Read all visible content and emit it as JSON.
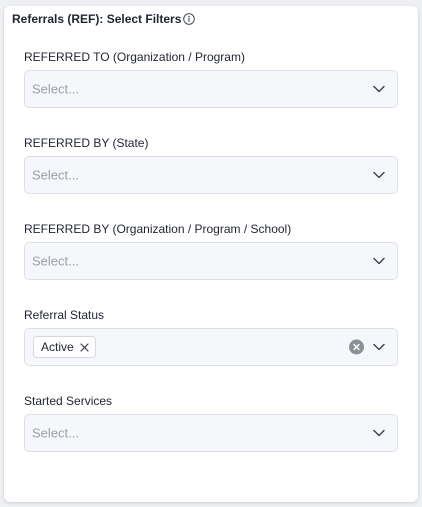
{
  "panel": {
    "title": "Referrals (REF): Select Filters"
  },
  "filters": [
    {
      "label": "REFERRED TO (Organization / Program)",
      "placeholder": "Select..."
    },
    {
      "label": "REFERRED BY (State)",
      "placeholder": "Select..."
    },
    {
      "label": "REFERRED BY (Organization / Program / School)",
      "placeholder": "Select..."
    },
    {
      "label": "Referral Status",
      "selected_tags": [
        "Active"
      ]
    },
    {
      "label": "Started Services",
      "placeholder": "Select..."
    }
  ],
  "icons": {
    "info": "info-icon",
    "dropdown": "chevron-down-icon",
    "clear": "clear-icon",
    "tag_remove": "close-icon"
  },
  "colors": {
    "panel_bg": "#ffffff",
    "field_bg": "#f6f7fa",
    "border": "#dde1e7",
    "placeholder": "#9aa0aa",
    "clear_button": "#8b919b"
  }
}
